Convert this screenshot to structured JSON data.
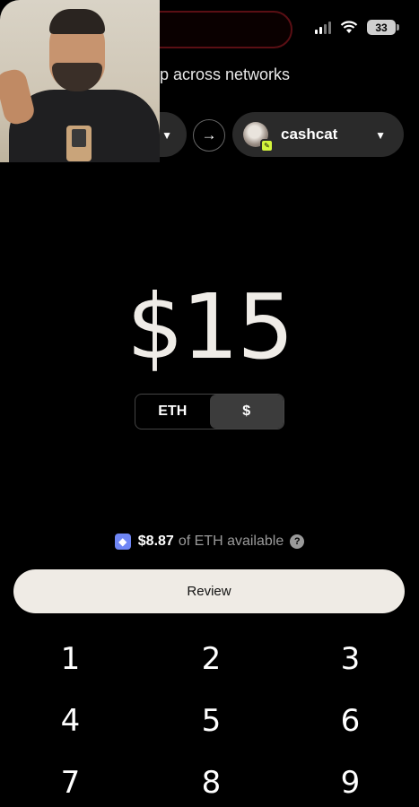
{
  "status_bar": {
    "battery": "33"
  },
  "header": {
    "subtitle": "p across networks"
  },
  "network": {
    "arrow": "→",
    "to_label": "cashcat"
  },
  "amount": {
    "value": "$15"
  },
  "unit_toggle": {
    "options": [
      "ETH",
      "$"
    ],
    "selected": "$"
  },
  "balance": {
    "amount": "$8.87",
    "text": "of ETH available",
    "help": "?"
  },
  "review_button": {
    "label": "Review"
  },
  "keypad": {
    "keys": [
      "1",
      "2",
      "3",
      "4",
      "5",
      "6",
      "7",
      "8",
      "9"
    ]
  },
  "colors": {
    "accent_badge": "#d4f53c",
    "eth_icon": "#6f86f5",
    "review_bg": "#efebe5"
  }
}
